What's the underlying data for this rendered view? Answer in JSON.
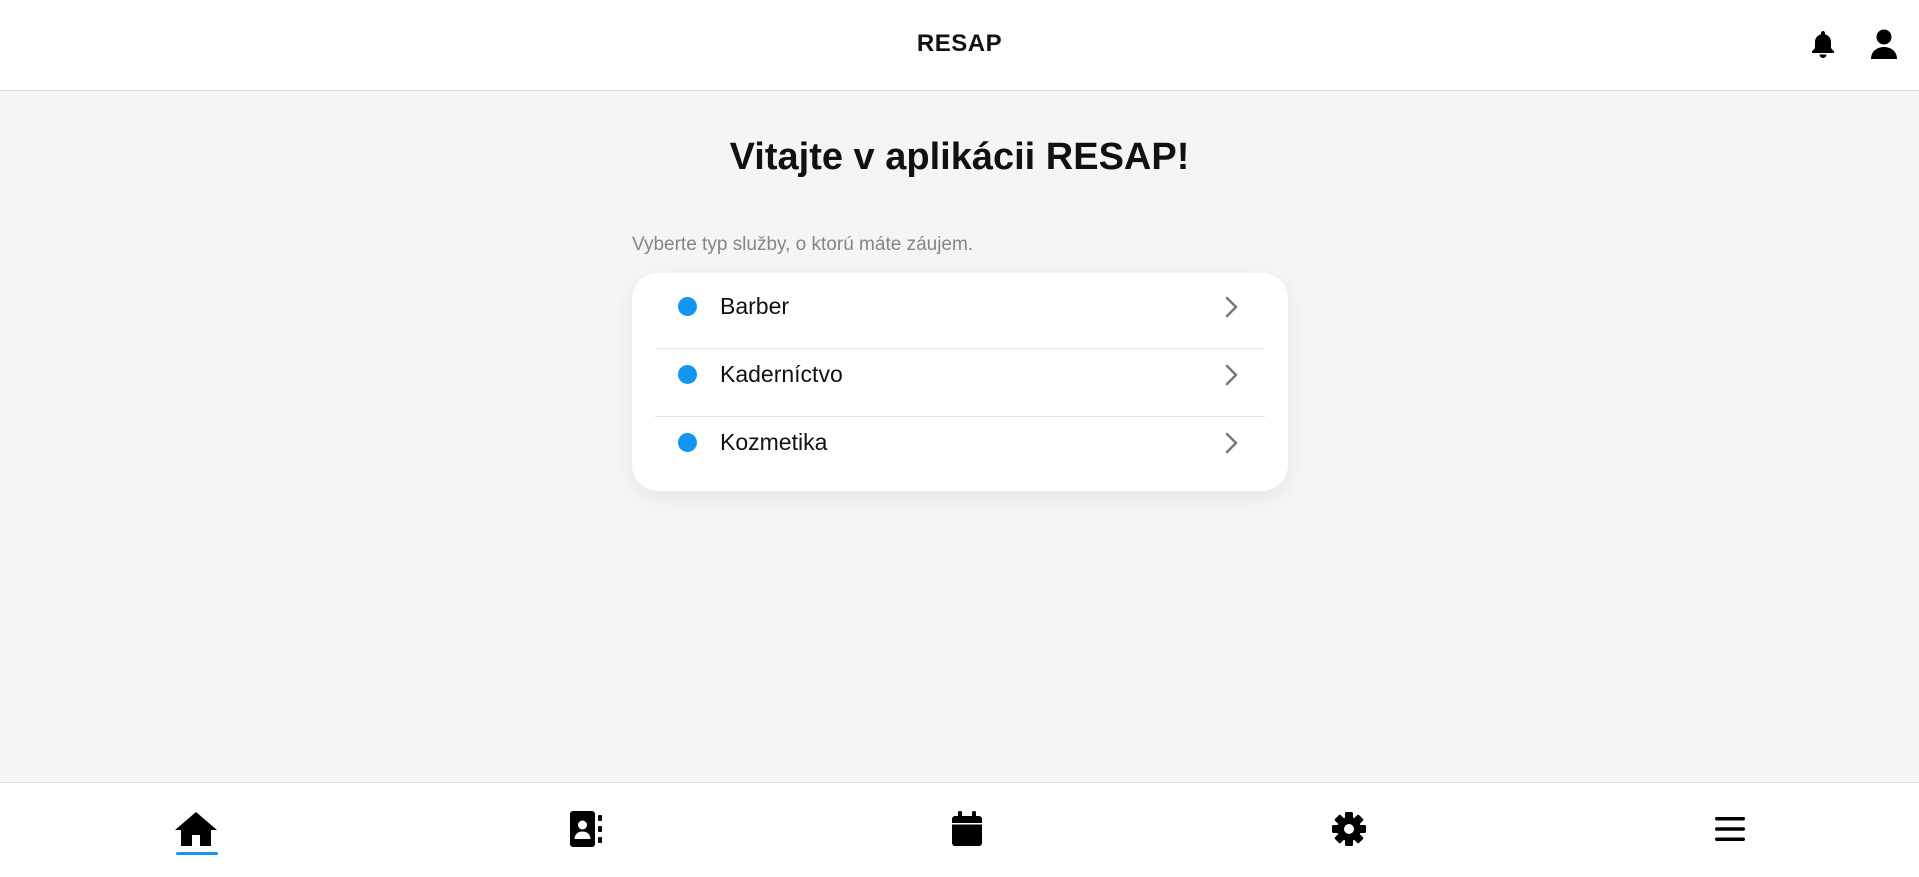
{
  "header": {
    "title": "RESAP",
    "icons": [
      "bell-icon",
      "user-icon"
    ]
  },
  "main": {
    "welcome": "Vitajte v aplikácii RESAP!",
    "subtitle": "Vyberte typ služby, o ktorú máte záujem.",
    "services": [
      {
        "label": "Barber"
      },
      {
        "label": "Kaderníctvo"
      },
      {
        "label": "Kozmetika"
      }
    ]
  },
  "bottom_nav": {
    "items": [
      "home-icon",
      "contacts-icon",
      "calendar-icon",
      "settings-icon",
      "menu-icon"
    ],
    "active": "home-icon"
  },
  "colors": {
    "accent": "#1296ef",
    "background": "#f4f5f7",
    "card": "#ffffff",
    "subtitle_text": "#858585"
  }
}
